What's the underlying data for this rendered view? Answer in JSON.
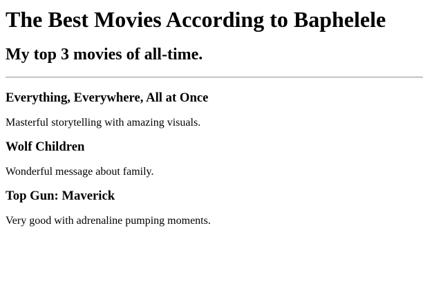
{
  "page": {
    "title": "The Best Movies According to Baphelele",
    "subtitle": "My top 3 movies of all-time."
  },
  "movies": [
    {
      "title": "Everything, Everywhere, All at Once",
      "description": "Masterful storytelling with amazing visuals."
    },
    {
      "title": "Wolf Children",
      "description": "Wonderful message about family."
    },
    {
      "title": "Top Gun: Maverick",
      "description": "Very good with adrenaline pumping moments."
    }
  ]
}
